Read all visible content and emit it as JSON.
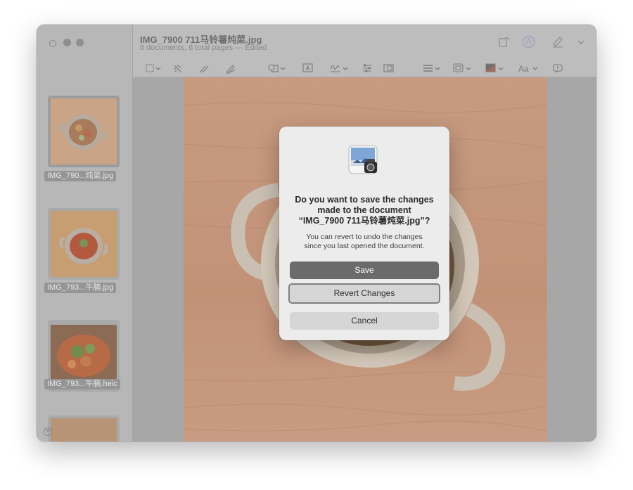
{
  "window": {
    "title": "IMG_7900 711马铃薯炖菜.jpg",
    "subtitle": "6 documents, 6 total pages — Edited"
  },
  "toolbar": {
    "items": [
      {
        "icon": "rectangle-selection-icon"
      },
      {
        "icon": "instant-alpha-icon"
      },
      {
        "icon": "sketch-icon"
      },
      {
        "icon": "draw-icon"
      },
      {
        "icon": "shapes-icon"
      },
      {
        "icon": "text-box-icon"
      },
      {
        "icon": "signature-icon"
      },
      {
        "icon": "adjust-color-icon"
      },
      {
        "icon": "adjust-size-icon"
      },
      {
        "icon": "shape-style-icon"
      },
      {
        "icon": "border-color-icon"
      },
      {
        "icon": "fill-color-icon"
      },
      {
        "icon": "text-style-icon",
        "label": "Aa"
      },
      {
        "icon": "description-icon"
      }
    ],
    "right": [
      {
        "icon": "rotate-icon"
      },
      {
        "icon": "markup-icon"
      },
      {
        "icon": "highlight-pen-icon"
      },
      {
        "icon": "chevron-down-icon"
      }
    ]
  },
  "sidebar": {
    "thumbnails": [
      {
        "label": "IMG_790...炖菜.jpg",
        "selected": true
      },
      {
        "label": "IMG_793...牛腩.jpg",
        "selected": false
      },
      {
        "label": "IMG_793...牛腩.heic",
        "selected": false
      },
      {
        "label": "",
        "selected": false
      }
    ]
  },
  "dialog": {
    "title_line1": "Do you want to save the changes",
    "title_line2": "made to the document",
    "title_line3": "“IMG_7900 711马铃薯炖菜.jpg”?",
    "message_line1": "You can revert to undo the changes",
    "message_line2": "since you last opened the document.",
    "save_label": "Save",
    "revert_label": "Revert Changes",
    "cancel_label": "Cancel"
  },
  "colors": {
    "dim_overlay": "#b9b9b9",
    "dialog_bg": "#ececec",
    "default_button": "#6b6b6b",
    "focus_ring": "#7f7f7f"
  }
}
